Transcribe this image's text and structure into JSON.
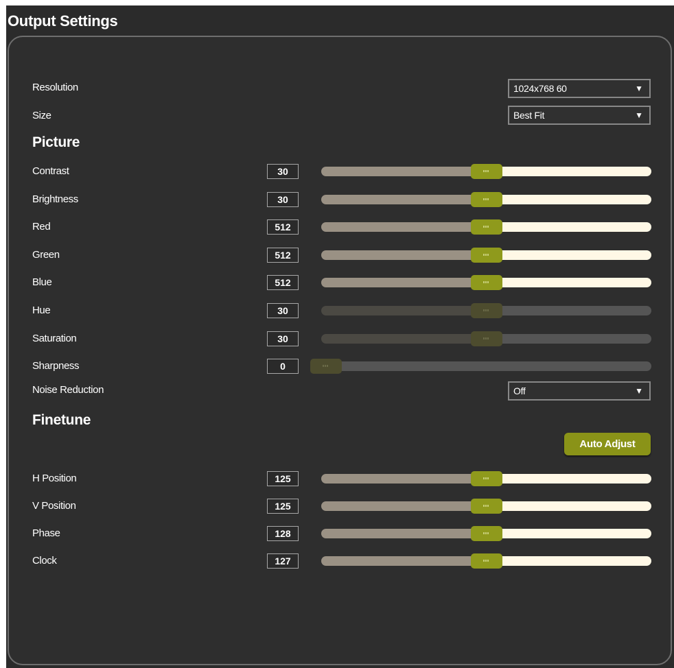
{
  "page": {
    "title": "Output Settings"
  },
  "accent_color": "#8f9a1c",
  "resolution": {
    "label": "Resolution",
    "value": "1024x768 60"
  },
  "size": {
    "label": "Size",
    "value": "Best Fit"
  },
  "dropdown_icon": "triangle-down-icon",
  "picture": {
    "heading": "Picture",
    "rows": [
      {
        "label": "Contrast",
        "value": "30",
        "level": 0.5,
        "enabled": true
      },
      {
        "label": "Brightness",
        "value": "30",
        "level": 0.5,
        "enabled": true
      },
      {
        "label": "Red",
        "value": "512",
        "level": 0.5,
        "enabled": true
      },
      {
        "label": "Green",
        "value": "512",
        "level": 0.5,
        "enabled": true
      },
      {
        "label": "Blue",
        "value": "512",
        "level": 0.5,
        "enabled": true
      },
      {
        "label": "Hue",
        "value": "30",
        "level": 0.5,
        "enabled": false
      },
      {
        "label": "Saturation",
        "value": "30",
        "level": 0.5,
        "enabled": false
      },
      {
        "label": "Sharpness",
        "value": "0",
        "level": 0.0,
        "enabled": false
      }
    ]
  },
  "noise_reduction": {
    "label": "Noise Reduction",
    "value": "Off"
  },
  "finetune": {
    "heading": "Finetune",
    "auto_adjust_label": "Auto Adjust",
    "rows": [
      {
        "label": "H Position",
        "value": "125",
        "level": 0.5,
        "enabled": true
      },
      {
        "label": "V Position",
        "value": "125",
        "level": 0.5,
        "enabled": true
      },
      {
        "label": "Phase",
        "value": "128",
        "level": 0.5,
        "enabled": true
      },
      {
        "label": "Clock",
        "value": "127",
        "level": 0.5,
        "enabled": true
      }
    ]
  }
}
